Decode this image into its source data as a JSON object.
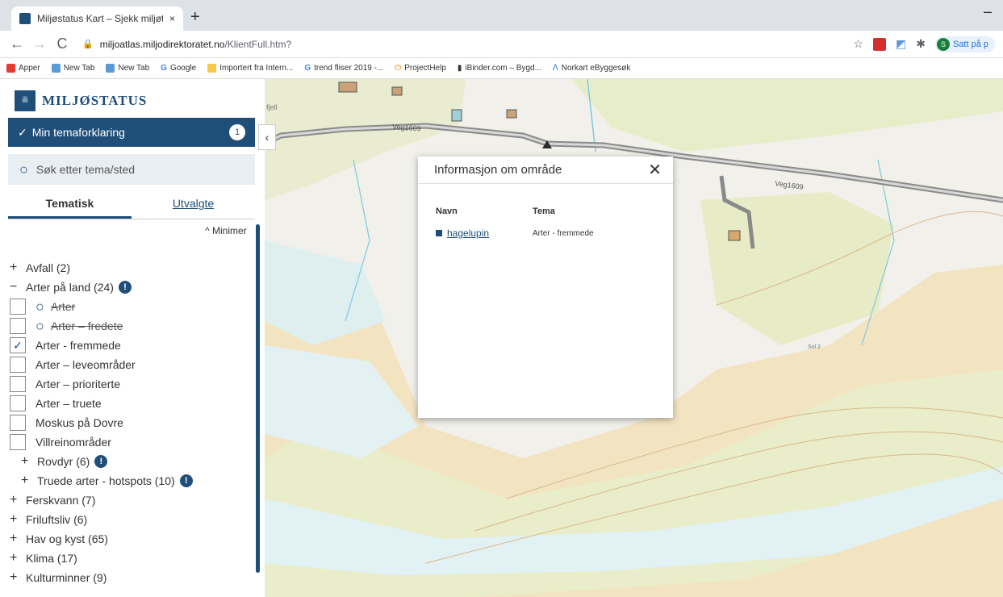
{
  "browser": {
    "tab_title": "Miljøstatus Kart – Sjekk miljøtilst",
    "tab_close": "×",
    "new_tab": "+",
    "minimize": "–",
    "url_host": "miljoatlas.miljodirektoratet.no",
    "url_path": "/KlientFull.htm?",
    "profile_label": "Satt på p",
    "profile_initial": "S",
    "bookmarks": [
      {
        "label": "Apper",
        "color": "#e53935"
      },
      {
        "label": "New Tab",
        "color": "#5b9bd5"
      },
      {
        "label": "New Tab",
        "color": "#5b9bd5"
      },
      {
        "label": "Google",
        "color": "#4285f4"
      },
      {
        "label": "Importert fra Intern...",
        "color": "#f9c846"
      },
      {
        "label": "trend fliser 2019 -...",
        "color": "#4285f4"
      },
      {
        "label": "ProjectHelp",
        "color": "#f57c00"
      },
      {
        "label": "iBinder.com – Bygd...",
        "color": "#333333"
      },
      {
        "label": "Norkart eByggesøk",
        "color": "#1a73e8"
      }
    ]
  },
  "sidebar": {
    "logo_text": "MILJØSTATUS",
    "tema_button": "Min temaforklaring",
    "tema_badge": "1",
    "search_placeholder": "Søk etter tema/sted",
    "tab_tematisk": "Tematisk",
    "tab_utvalgte": "Utvalgte",
    "minimer": "Minimer",
    "tree": {
      "avfall": "Avfall (2)",
      "arter_paa_land": "Arter på land (24)",
      "items": [
        {
          "label": "Arter",
          "checked": false,
          "zoom": true,
          "strike": true
        },
        {
          "label": "Arter – fredete",
          "checked": false,
          "zoom": true,
          "strike": true
        },
        {
          "label": "Arter - fremmede",
          "checked": true,
          "zoom": false,
          "strike": false
        },
        {
          "label": "Arter – leveområder",
          "checked": false,
          "zoom": false,
          "strike": false
        },
        {
          "label": "Arter – prioriterte",
          "checked": false,
          "zoom": false,
          "strike": false
        },
        {
          "label": "Arter – truete",
          "checked": false,
          "zoom": false,
          "strike": false
        },
        {
          "label": "Moskus på Dovre",
          "checked": false,
          "zoom": false,
          "strike": false
        },
        {
          "label": "Villreinområder",
          "checked": false,
          "zoom": false,
          "strike": false
        }
      ],
      "rovdyr": "Rovdyr (6)",
      "truede": "Truede arter - hotspots (10)",
      "ferskvann": "Ferskvann (7)",
      "friluftsliv": "Friluftsliv (6)",
      "hav_og_kyst": "Hav og kyst (65)",
      "klima": "Klima (17)",
      "kulturminner": "Kulturminner (9)"
    }
  },
  "map": {
    "road_label_1": "Veg1609",
    "road_label_2": "Veg1609",
    "place_label": "Sol 2",
    "fjell_label": "fjell",
    "popup": {
      "title": "Informasjon om område",
      "col_navn": "Navn",
      "col_tema": "Tema",
      "row_navn": "hagelupin",
      "row_tema": "Arter - fremmede"
    }
  }
}
